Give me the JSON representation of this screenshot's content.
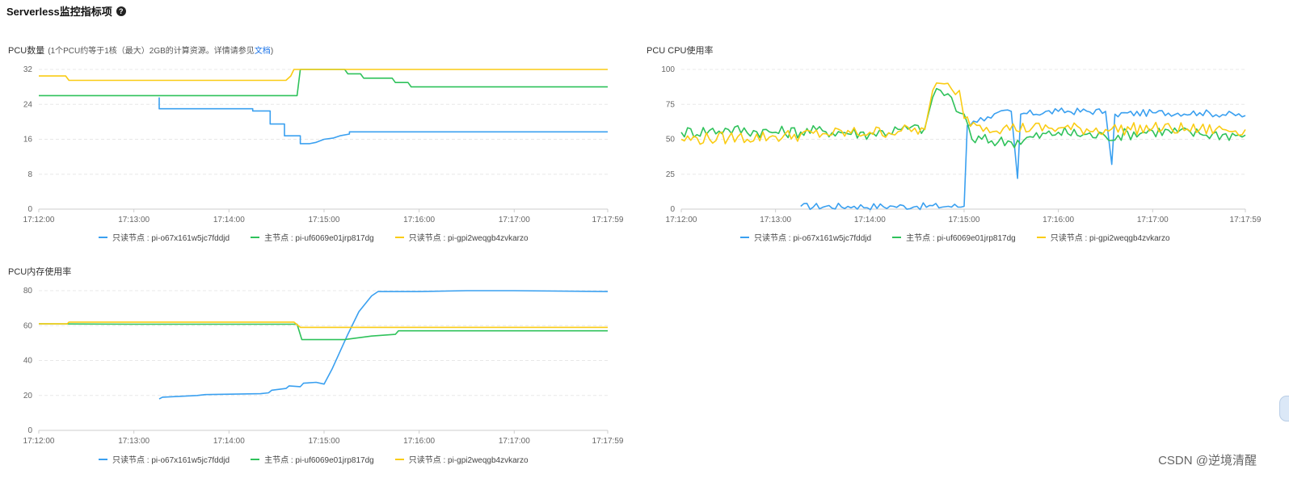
{
  "page": {
    "title": "Serverless监控指标项"
  },
  "colors": {
    "blue": "#3aa0f0",
    "green": "#2fc25b",
    "yellow": "#facc14",
    "grid": "#e8e8e8",
    "axis": "#cccccc"
  },
  "legend_names": [
    "只读节点 : pi-o67x161w5jc7fddjd",
    "主节点 : pi-uf6069e01jrp817dg",
    "只读节点 : pi-gpi2weqgb4zvkarzo"
  ],
  "panels": {
    "pcu": {
      "title": "PCU数量",
      "subtitle": "(1个PCU约等于1核（最大）2GB的计算资源。详情请参见",
      "doc_link": "文档",
      "subtitle_end": ")"
    },
    "cpu": {
      "title": "PCU CPU使用率"
    },
    "mem": {
      "title": "PCU内存使用率"
    }
  },
  "watermark": "CSDN @逆境清醒",
  "chart_data": [
    {
      "type": "line",
      "title": "PCU数量",
      "x_ticks": [
        "17:12:00",
        "17:13:00",
        "17:14:00",
        "17:15:00",
        "17:16:00",
        "17:17:00",
        "17:17:59"
      ],
      "x_range": [
        "17:12:00",
        "17:17:59"
      ],
      "y_ticks": [
        0,
        8,
        16,
        24,
        32
      ],
      "ylim": [
        0,
        32
      ],
      "grid": true,
      "legend": "bottom",
      "series": [
        {
          "name": "只读节点 : pi-o67x161w5jc7fddjd",
          "color": "#3aa0f0",
          "points": [
            [
              "17:13:16",
              25.6
            ],
            [
              "17:13:16",
              23
            ],
            [
              "17:14:15",
              23
            ],
            [
              "17:14:15",
              22.5
            ],
            [
              "17:14:26",
              22.5
            ],
            [
              "17:14:26",
              19.5
            ],
            [
              "17:14:35",
              19.5
            ],
            [
              "17:14:35",
              16.8
            ],
            [
              "17:14:45",
              16.8
            ],
            [
              "17:14:45",
              15
            ],
            [
              "17:14:51",
              15
            ],
            [
              "17:14:55",
              15.3
            ],
            [
              "17:15:00",
              16
            ],
            [
              "17:15:06",
              16.3
            ],
            [
              "17:15:10",
              16.8
            ],
            [
              "17:15:16",
              17.2
            ],
            [
              "17:15:16",
              17.7
            ],
            [
              "17:17:59",
              17.7
            ]
          ]
        },
        {
          "name": "主节点 : pi-uf6069e01jrp817dg",
          "color": "#2fc25b",
          "points": [
            [
              "17:12:00",
              26
            ],
            [
              "17:14:43",
              26
            ],
            [
              "17:14:45",
              32
            ],
            [
              "17:15:13",
              32
            ],
            [
              "17:15:15",
              31
            ],
            [
              "17:15:23",
              31
            ],
            [
              "17:15:25",
              30
            ],
            [
              "17:15:43",
              30
            ],
            [
              "17:15:45",
              29
            ],
            [
              "17:15:53",
              29
            ],
            [
              "17:15:55",
              28
            ],
            [
              "17:17:59",
              28
            ]
          ]
        },
        {
          "name": "只读节点 : pi-gpi2weqgb4zvkarzo",
          "color": "#facc14",
          "points": [
            [
              "17:12:00",
              30.5
            ],
            [
              "17:12:17",
              30.5
            ],
            [
              "17:12:19",
              29.5
            ],
            [
              "17:14:36",
              29.5
            ],
            [
              "17:14:39",
              30.5
            ],
            [
              "17:14:41",
              32
            ],
            [
              "17:17:59",
              32
            ]
          ]
        }
      ]
    },
    {
      "type": "line",
      "title": "PCU CPU使用率",
      "x_ticks": [
        "17:12:00",
        "17:13:00",
        "17:14:00",
        "17:15:00",
        "17:16:00",
        "17:17:00",
        "17:17:59"
      ],
      "x_range": [
        "17:12:00",
        "17:17:59"
      ],
      "y_ticks": [
        0,
        25,
        50,
        75,
        100
      ],
      "ylim": [
        0,
        100
      ],
      "grid": true,
      "legend": "bottom",
      "series": [
        {
          "name": "只读节点 : pi-o67x161w5jc7fddjd",
          "color": "#3aa0f0",
          "points": [
            [
              "17:13:16",
              2
            ],
            [
              "17:13:50",
              2
            ],
            [
              "17:14:15",
              2
            ],
            [
              "17:14:30",
              2
            ],
            [
              "17:14:50",
              2
            ],
            [
              "17:15:00",
              2
            ],
            [
              "17:15:02",
              60
            ],
            [
              "17:15:06",
              63
            ],
            [
              "17:15:15",
              66
            ],
            [
              "17:15:30",
              70
            ],
            [
              "17:15:34",
              22
            ],
            [
              "17:15:36",
              68
            ],
            [
              "17:16:00",
              70
            ],
            [
              "17:16:30",
              70
            ],
            [
              "17:16:34",
              32
            ],
            [
              "17:16:36",
              68
            ],
            [
              "17:17:00",
              69
            ],
            [
              "17:17:30",
              69
            ],
            [
              "17:17:59",
              67
            ]
          ]
        },
        {
          "name": "主节点 : pi-uf6069e01jrp817dg",
          "color": "#2fc25b",
          "points": [
            [
              "17:12:00",
              55
            ],
            [
              "17:12:30",
              57
            ],
            [
              "17:13:00",
              55
            ],
            [
              "17:13:30",
              56
            ],
            [
              "17:14:00",
              54
            ],
            [
              "17:14:20",
              57
            ],
            [
              "17:14:35",
              58
            ],
            [
              "17:14:40",
              80
            ],
            [
              "17:14:45",
              85
            ],
            [
              "17:14:52",
              80
            ],
            [
              "17:14:55",
              70
            ],
            [
              "17:15:00",
              68
            ],
            [
              "17:15:05",
              50
            ],
            [
              "17:15:30",
              48
            ],
            [
              "17:16:00",
              55
            ],
            [
              "17:16:30",
              52
            ],
            [
              "17:17:00",
              56
            ],
            [
              "17:17:30",
              54
            ],
            [
              "17:17:59",
              53
            ]
          ]
        },
        {
          "name": "只读节点 : pi-gpi2weqgb4zvkarzo",
          "color": "#facc14",
          "points": [
            [
              "17:12:00",
              50
            ],
            [
              "17:12:30",
              51
            ],
            [
              "17:13:00",
              52
            ],
            [
              "17:13:30",
              54
            ],
            [
              "17:14:00",
              55
            ],
            [
              "17:14:20",
              56
            ],
            [
              "17:14:35",
              57
            ],
            [
              "17:14:40",
              85
            ],
            [
              "17:14:45",
              90
            ],
            [
              "17:14:52",
              86
            ],
            [
              "17:14:57",
              85
            ],
            [
              "17:15:00",
              65
            ],
            [
              "17:15:10",
              60
            ],
            [
              "17:15:25",
              58
            ],
            [
              "17:16:00",
              58
            ],
            [
              "17:16:30",
              57
            ],
            [
              "17:17:00",
              58
            ],
            [
              "17:17:30",
              57
            ],
            [
              "17:17:59",
              57
            ]
          ]
        }
      ]
    },
    {
      "type": "line",
      "title": "PCU内存使用率",
      "x_ticks": [
        "17:12:00",
        "17:13:00",
        "17:14:00",
        "17:15:00",
        "17:16:00",
        "17:17:00",
        "17:17:59"
      ],
      "x_range": [
        "17:12:00",
        "17:17:59"
      ],
      "y_ticks": [
        0,
        20,
        40,
        60,
        80
      ],
      "ylim": [
        0,
        80
      ],
      "grid": true,
      "legend": "bottom",
      "series": [
        {
          "name": "只读节点 : pi-o67x161w5jc7fddjd",
          "color": "#3aa0f0",
          "points": [
            [
              "17:13:16",
              18
            ],
            [
              "17:13:18",
              19
            ],
            [
              "17:13:40",
              20
            ],
            [
              "17:13:45",
              20.5
            ],
            [
              "17:14:20",
              21
            ],
            [
              "17:14:25",
              21.5
            ],
            [
              "17:14:27",
              23
            ],
            [
              "17:14:36",
              24
            ],
            [
              "17:14:38",
              25.5
            ],
            [
              "17:14:45",
              25
            ],
            [
              "17:14:47",
              27
            ],
            [
              "17:14:55",
              27.5
            ],
            [
              "17:15:00",
              26.5
            ],
            [
              "17:15:05",
              35
            ],
            [
              "17:15:10",
              45
            ],
            [
              "17:15:15",
              55
            ],
            [
              "17:15:22",
              68
            ],
            [
              "17:15:30",
              77
            ],
            [
              "17:15:34",
              79.5
            ],
            [
              "17:16:00",
              79.5
            ],
            [
              "17:16:30",
              80
            ],
            [
              "17:17:00",
              80
            ],
            [
              "17:17:59",
              79.5
            ]
          ]
        },
        {
          "name": "主节点 : pi-uf6069e01jrp817dg",
          "color": "#2fc25b",
          "points": [
            [
              "17:12:00",
              61
            ],
            [
              "17:13:00",
              60.8
            ],
            [
              "17:14:43",
              60.8
            ],
            [
              "17:14:46",
              52
            ],
            [
              "17:15:13",
              52
            ],
            [
              "17:15:30",
              54
            ],
            [
              "17:15:45",
              55
            ],
            [
              "17:15:47",
              57
            ],
            [
              "17:17:59",
              57
            ]
          ]
        },
        {
          "name": "只读节点 : pi-gpi2weqgb4zvkarzo",
          "color": "#facc14",
          "points": [
            [
              "17:12:00",
              61
            ],
            [
              "17:12:18",
              61
            ],
            [
              "17:12:19",
              62
            ],
            [
              "17:14:41",
              62
            ],
            [
              "17:14:45",
              59
            ],
            [
              "17:17:59",
              59
            ]
          ]
        }
      ]
    }
  ]
}
